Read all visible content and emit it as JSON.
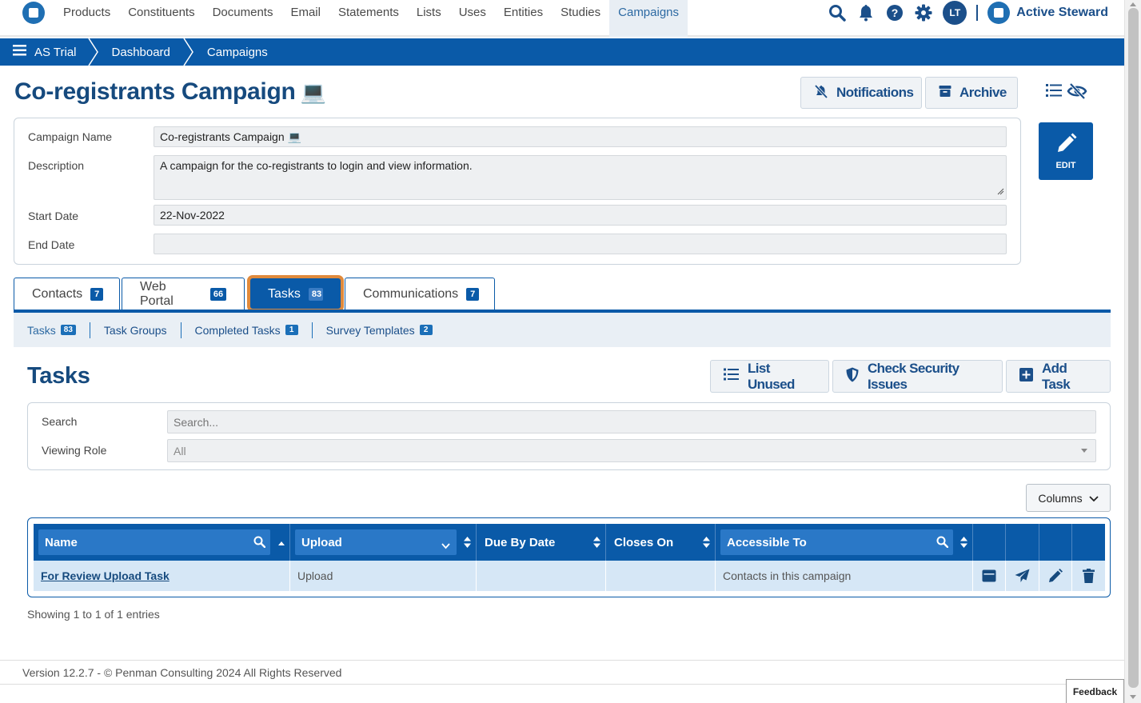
{
  "nav": {
    "items": [
      "Products",
      "Constituents",
      "Documents",
      "Email",
      "Statements",
      "Lists",
      "Uses",
      "Entities",
      "Studies",
      "Campaigns"
    ],
    "active": "Campaigns",
    "avatar_initials": "LT",
    "brand": "Active Steward"
  },
  "breadcrumb": [
    "AS Trial",
    "Dashboard",
    "Campaigns"
  ],
  "page": {
    "title": "Co-registrants Campaign",
    "title_icon": "💻",
    "notifications_label": "Notifications",
    "archive_label": "Archive",
    "edit_label": "EDIT"
  },
  "form": {
    "campaign_name_label": "Campaign Name",
    "campaign_name_value": "Co-registrants Campaign 💻",
    "description_label": "Description",
    "description_value": "A campaign for the co-registrants to login and view information.",
    "start_date_label": "Start Date",
    "start_date_value": "22-Nov-2022",
    "end_date_label": "End Date",
    "end_date_value": ""
  },
  "tabs": [
    {
      "label": "Contacts",
      "count": "7"
    },
    {
      "label": "Web Portal",
      "count": "66"
    },
    {
      "label": "Tasks",
      "count": "83"
    },
    {
      "label": "Communications",
      "count": "7"
    }
  ],
  "subtabs": [
    {
      "label": "Tasks",
      "count": "83"
    },
    {
      "label": "Task Groups",
      "count": ""
    },
    {
      "label": "Completed Tasks",
      "count": "1"
    },
    {
      "label": "Survey Templates",
      "count": "2"
    }
  ],
  "tasks": {
    "title": "Tasks",
    "list_unused_label": "List Unused",
    "check_security_label": "Check Security Issues",
    "add_task_label": "Add Task",
    "search_label": "Search",
    "search_placeholder": "Search...",
    "viewing_role_label": "Viewing Role",
    "viewing_role_value": "All",
    "columns_label": "Columns"
  },
  "table": {
    "headers": [
      "Name",
      "Upload",
      "Due By Date",
      "Closes On",
      "Accessible To"
    ],
    "rows": [
      {
        "name": "For Review Upload Task",
        "upload": "Upload",
        "due_by": "",
        "closes_on": "",
        "accessible_to": "Contacts in this campaign"
      }
    ],
    "showing": "Showing 1 to 1 of 1 entries"
  },
  "footer": {
    "text": "Version 12.2.7 - © Penman Consulting 2024 All Rights Reserved",
    "feedback": "Feedback"
  },
  "colors": {
    "primary": "#0a5aa8",
    "heading": "#164a7e",
    "highlight": "#e08a3c"
  }
}
